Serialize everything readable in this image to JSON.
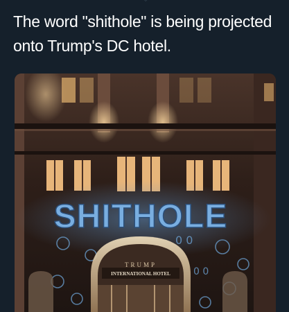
{
  "tweet": {
    "text": "The word \"shithole\" is being projected onto Trump's DC hotel."
  },
  "media": {
    "projected_word": "SHITHOLE",
    "sign_top": "TRUMP",
    "sign_bottom": "INTERNATIONAL HOTEL",
    "projection_color": "#6fa8dc",
    "building_color": "#3a2720"
  }
}
